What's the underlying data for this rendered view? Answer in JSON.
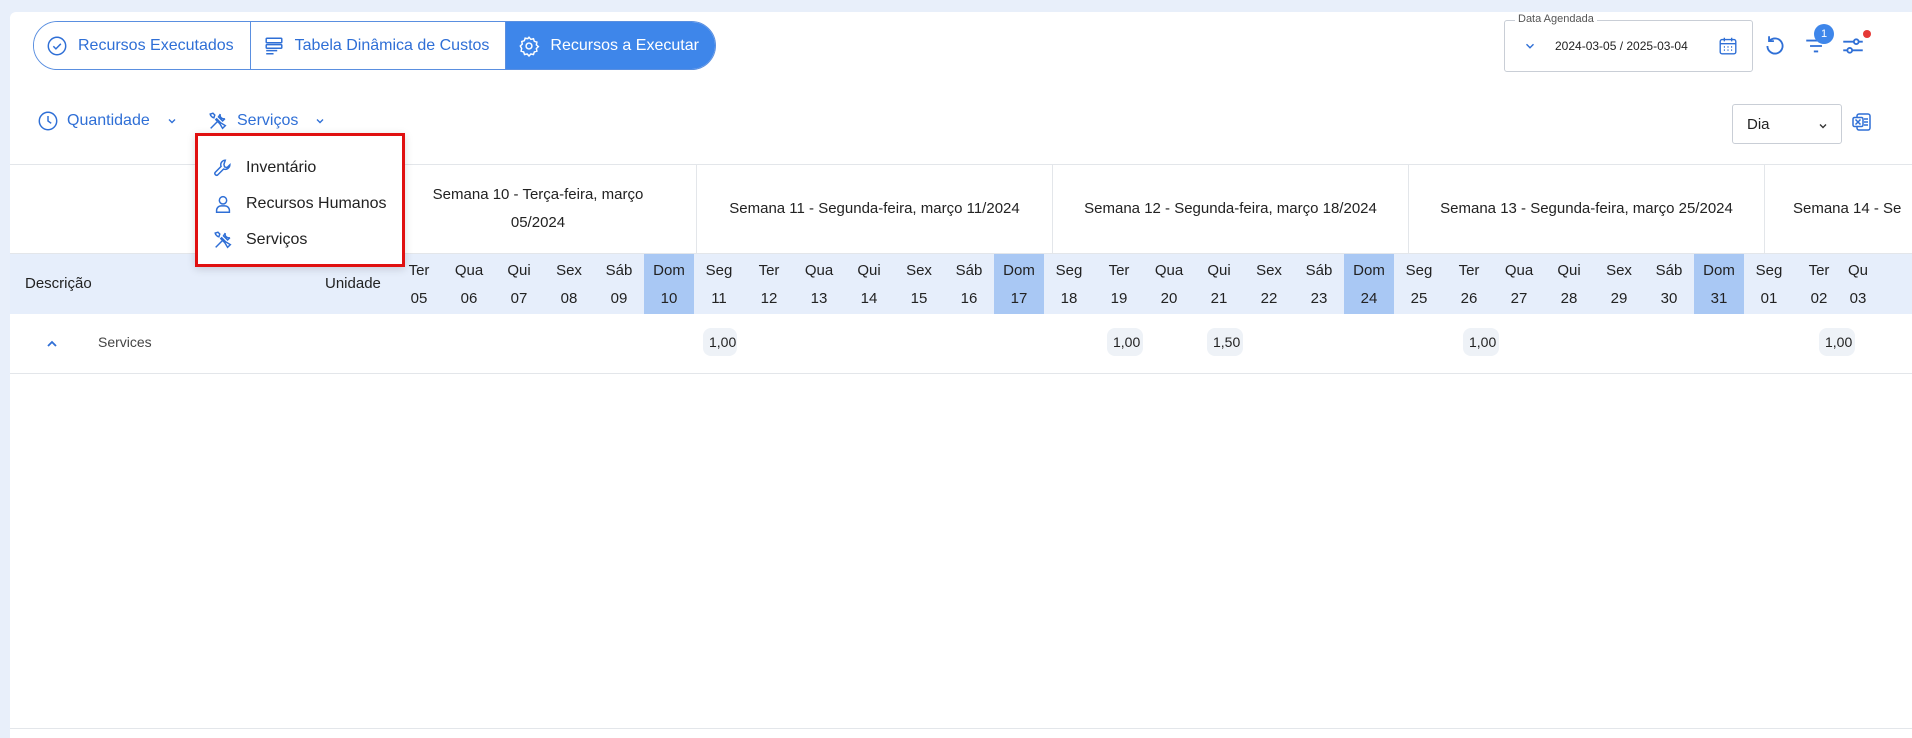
{
  "tabs": [
    {
      "label": "Recursos Executados",
      "icon": "check-circle-icon",
      "active": false
    },
    {
      "label": "Tabela Dinâmica de Custos",
      "icon": "table-icon",
      "active": false
    },
    {
      "label": "Recursos a Executar",
      "icon": "gear-icon",
      "active": true
    }
  ],
  "date_filter": {
    "label": "Data Agendada",
    "value": "2024-03-05 / 2025-03-04"
  },
  "filter_badge": "1",
  "toolbar": {
    "quantity_label": "Quantidade",
    "services_label": "Serviços",
    "period_select": "Dia"
  },
  "menu": {
    "items": [
      {
        "label": "Inventário",
        "icon": "wrench-icon"
      },
      {
        "label": "Recursos Humanos",
        "icon": "person-icon"
      },
      {
        "label": "Serviços",
        "icon": "tools-icon"
      }
    ]
  },
  "table": {
    "col_description": "Descrição",
    "col_unit": "Unidade",
    "weeks": [
      {
        "label": "Semana 10 - Terça-feira, março 05/2024"
      },
      {
        "label": "Semana 11 - Segunda-feira, março 11/2024"
      },
      {
        "label": "Semana 12 - Segunda-feira, março 18/2024"
      },
      {
        "label": "Semana 13 - Segunda-feira, março 25/2024"
      },
      {
        "label": "Semana 14 - Se"
      }
    ],
    "days": [
      {
        "name": "Ter",
        "num": "05"
      },
      {
        "name": "Qua",
        "num": "06"
      },
      {
        "name": "Qui",
        "num": "07"
      },
      {
        "name": "Sex",
        "num": "08"
      },
      {
        "name": "Sáb",
        "num": "09"
      },
      {
        "name": "Dom",
        "num": "10"
      },
      {
        "name": "Seg",
        "num": "11"
      },
      {
        "name": "Ter",
        "num": "12"
      },
      {
        "name": "Qua",
        "num": "13"
      },
      {
        "name": "Qui",
        "num": "14"
      },
      {
        "name": "Sex",
        "num": "15"
      },
      {
        "name": "Sáb",
        "num": "16"
      },
      {
        "name": "Dom",
        "num": "17"
      },
      {
        "name": "Seg",
        "num": "18"
      },
      {
        "name": "Ter",
        "num": "19"
      },
      {
        "name": "Qua",
        "num": "20"
      },
      {
        "name": "Qui",
        "num": "21"
      },
      {
        "name": "Sex",
        "num": "22"
      },
      {
        "name": "Sáb",
        "num": "23"
      },
      {
        "name": "Dom",
        "num": "24"
      },
      {
        "name": "Seg",
        "num": "25"
      },
      {
        "name": "Ter",
        "num": "26"
      },
      {
        "name": "Qua",
        "num": "27"
      },
      {
        "name": "Qui",
        "num": "28"
      },
      {
        "name": "Sex",
        "num": "29"
      },
      {
        "name": "Sáb",
        "num": "30"
      },
      {
        "name": "Dom",
        "num": "31"
      },
      {
        "name": "Seg",
        "num": "01"
      },
      {
        "name": "Ter",
        "num": "02"
      },
      {
        "name": "Qu",
        "num": "03"
      }
    ],
    "row": {
      "label": "Services",
      "values": [
        "1,00",
        "1,00",
        "1,50",
        "1,00",
        "1,00"
      ]
    }
  }
}
